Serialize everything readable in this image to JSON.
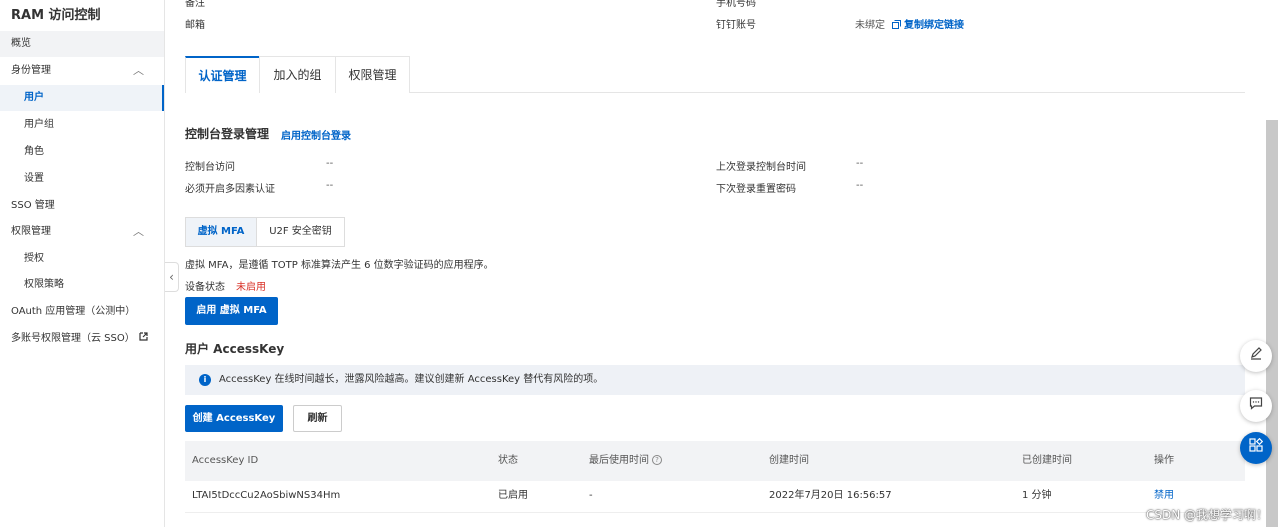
{
  "sidebar": {
    "title": "RAM 访问控制",
    "items": [
      {
        "label": "概览"
      },
      {
        "label": "身份管理",
        "chevron": "︿"
      },
      {
        "label": "用户"
      },
      {
        "label": "用户组"
      },
      {
        "label": "角色"
      },
      {
        "label": "设置"
      },
      {
        "label": "SSO 管理"
      },
      {
        "label": "权限管理",
        "chevron": "︿"
      },
      {
        "label": "授权"
      },
      {
        "label": "权限策略"
      },
      {
        "label": "OAuth 应用管理（公测中）"
      },
      {
        "label": "多账号权限管理（云 SSO）",
        "icon": "external-link-icon"
      }
    ],
    "collapse_glyph": "‹"
  },
  "info": {
    "remark_label": "备注",
    "email_label": "邮箱",
    "phone_label": "手机号码",
    "dingtalk_label": "钉钉账号",
    "dingtalk_value": "未绑定",
    "dingtalk_link": "复制绑定链接"
  },
  "tabs": [
    "认证管理",
    "加入的组",
    "权限管理"
  ],
  "console": {
    "title": "控制台登录管理",
    "enable_link": "启用控制台登录",
    "access_label": "控制台访问",
    "access_value": "--",
    "mfa_label": "必须开启多因素认证",
    "mfa_value": "--",
    "last_login_label": "上次登录控制台时间",
    "last_login_value": "--",
    "reset_label": "下次登录重置密码",
    "reset_value": "--"
  },
  "mfa": {
    "tabs": [
      "虚拟 MFA",
      "U2F 安全密钥"
    ],
    "description": "虚拟 MFA，是遵循 TOTP 标准算法产生 6 位数字验证码的应用程序。",
    "status_label": "设备状态",
    "status_value": "未启用",
    "enable_button": "启用 虚拟 MFA"
  },
  "accesskey": {
    "title": "用户 AccessKey",
    "notice": "AccessKey 在线时间越长，泄露风险越高。建议创建新 AccessKey 替代有风险的项。",
    "create_button": "创建 AccessKey",
    "refresh_button": "刷新",
    "columns": [
      "AccessKey ID",
      "状态",
      "最后使用时间",
      "创建时间",
      "已创建时间",
      "操作"
    ],
    "rows": [
      {
        "id": "LTAI5tDccCu2AoSbiwNS34Hm",
        "status": "已启用",
        "last_used": "-",
        "created": "2022年7月20日 16:56:57",
        "age": "1 分钟",
        "action": "禁用"
      }
    ]
  },
  "watermark": "CSDN @我想学习啊！",
  "colors": {
    "accent": "#0064c8",
    "danger": "#d93026"
  }
}
